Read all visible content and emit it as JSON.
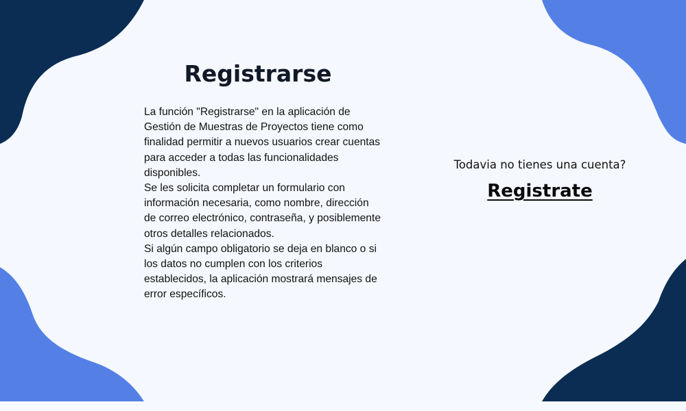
{
  "title": "Registrarse",
  "description": [
    "La función \"Registrarse\" en la aplicación de Gestión de Muestras de Proyectos tiene como finalidad permitir a nuevos usuarios crear cuentas para acceder a todas las funcionalidades disponibles.",
    "Se les solicita completar un formulario con información necesaria, como nombre, dirección de correo electrónico, contraseña, y posiblemente otros detalles relacionados.",
    "Si algún campo obligatorio se deja en blanco o si los datos no cumplen con los criterios establecidos, la aplicación mostrará mensajes de error específicos."
  ],
  "signup_prompt": "Todavia no tienes una cuenta?",
  "signup_link": "Registrate",
  "colors": {
    "background": "#f5f8fe",
    "dark_navy": "#0b2d53",
    "blue": "#5480e6",
    "text": "#111111"
  }
}
